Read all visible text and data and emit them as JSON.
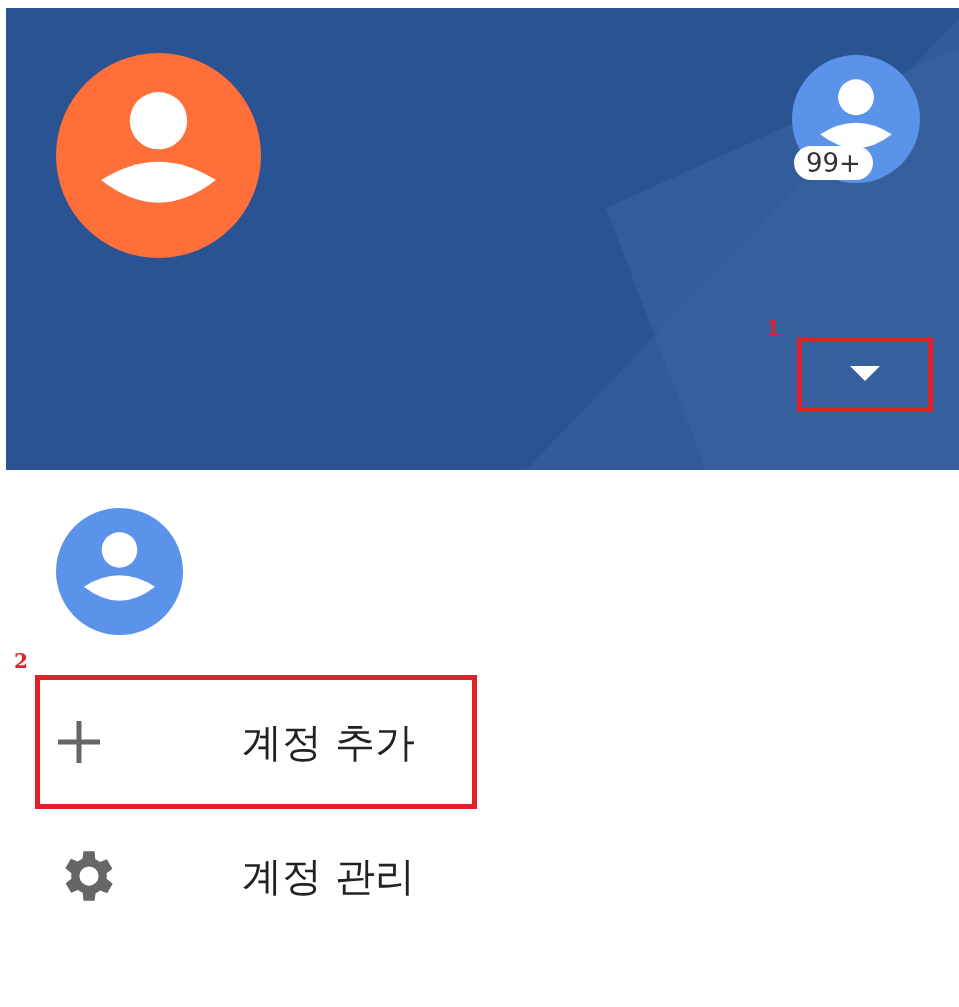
{
  "header": {
    "account_badge": "99+",
    "annotation": {
      "number": "1",
      "color": "#e0202a"
    }
  },
  "accounts": [
    {
      "kind": "avatar"
    }
  ],
  "menu": [
    {
      "kind": "add",
      "label": "계정 추가",
      "annotation": {
        "number": "2",
        "color": "#e0202a"
      }
    },
    {
      "kind": "manage",
      "label": "계정 관리"
    }
  ]
}
